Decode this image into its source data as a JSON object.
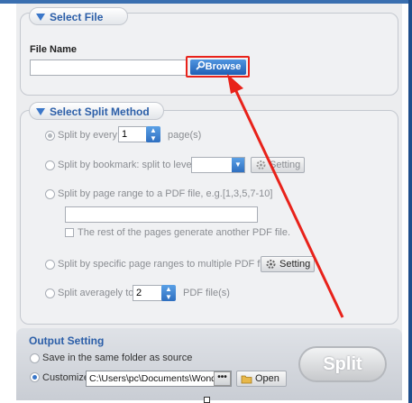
{
  "select_file": {
    "header": "Select File",
    "file_name_label": "File Name",
    "file_name_value": "",
    "browse_label": "Browse"
  },
  "split_method": {
    "header": "Select Split Method",
    "every": {
      "label": "Split by every",
      "value": "1",
      "unit": "page(s)"
    },
    "bookmark": {
      "label": "Split by bookmark: split to level",
      "value": "",
      "setting_label": "Setting"
    },
    "page_range": {
      "label": "Split by page range to a PDF file, e.g.[1,3,5,7-10]",
      "value": "",
      "rest_label": "The rest of the pages generate another PDF file."
    },
    "specific": {
      "label": "Split by specific page ranges to multiple PDF files",
      "setting_label": "Setting"
    },
    "average": {
      "label": "Split averagely to",
      "value": "2",
      "unit": "PDF file(s)"
    }
  },
  "output": {
    "header": "Output Setting",
    "same_folder_label": "Save in the same folder as source",
    "customize_label": "Customize",
    "path_value": "C:\\Users\\pc\\Documents\\Wond",
    "dots_label": "•••",
    "open_label": "Open"
  },
  "split_button_label": "Split",
  "colors": {
    "accent": "#2b5ea8",
    "highlight": "#e8221a"
  },
  "icons": [
    "chevron-down-icon",
    "search-icon",
    "gear-icon",
    "folder-icon",
    "spin-arrows-icon",
    "dropdown-arrow-icon"
  ]
}
